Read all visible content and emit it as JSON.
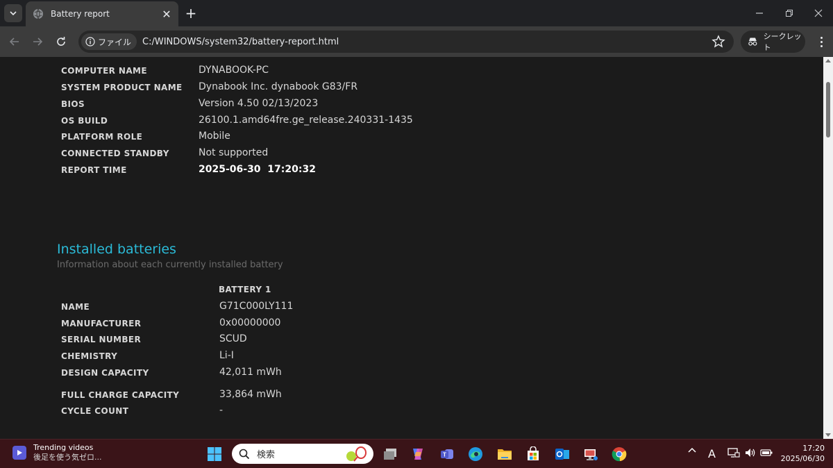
{
  "browser": {
    "tab_title": "Battery report",
    "address_chip": "ファイル",
    "url": "C:/WINDOWS/system32/battery-report.html",
    "incognito_label": "シークレット"
  },
  "system_info": [
    {
      "label": "COMPUTER NAME",
      "value": "DYNABOOK-PC"
    },
    {
      "label": "SYSTEM PRODUCT NAME",
      "value": "Dynabook Inc. dynabook G83/FR"
    },
    {
      "label": "BIOS",
      "value": "Version 4.50 02/13/2023"
    },
    {
      "label": "OS BUILD",
      "value": "26100.1.amd64fre.ge_release.240331-1435"
    },
    {
      "label": "PLATFORM ROLE",
      "value": "Mobile"
    },
    {
      "label": "CONNECTED STANDBY",
      "value": "Not supported"
    },
    {
      "label": "REPORT TIME",
      "value": "2025-06-30  17:20:32"
    }
  ],
  "installed_batteries": {
    "title": "Installed batteries",
    "subtitle": "Information about each currently installed battery",
    "column_header": "BATTERY 1",
    "rows": [
      {
        "label": "NAME",
        "value": "G71C000LY111"
      },
      {
        "label": "MANUFACTURER",
        "value": "0x00000000"
      },
      {
        "label": "SERIAL NUMBER",
        "value": "SCUD"
      },
      {
        "label": "CHEMISTRY",
        "value": "Li-I"
      },
      {
        "label": "DESIGN CAPACITY",
        "value": "42,011 mWh"
      },
      {
        "label": "FULL CHARGE CAPACITY",
        "value": "33,864 mWh"
      },
      {
        "label": "CYCLE COUNT",
        "value": "-"
      }
    ]
  },
  "taskbar": {
    "widget_title": "Trending videos",
    "widget_subtitle": "後足を使う気ゼロ...",
    "search_placeholder": "検索",
    "ime_indicator": "A",
    "time": "17:20",
    "date": "2025/06/30"
  },
  "colors": {
    "accent_heading": "#2bbbd8",
    "taskbar_bg": "#3a1418",
    "content_bg": "#1b1b1b"
  }
}
